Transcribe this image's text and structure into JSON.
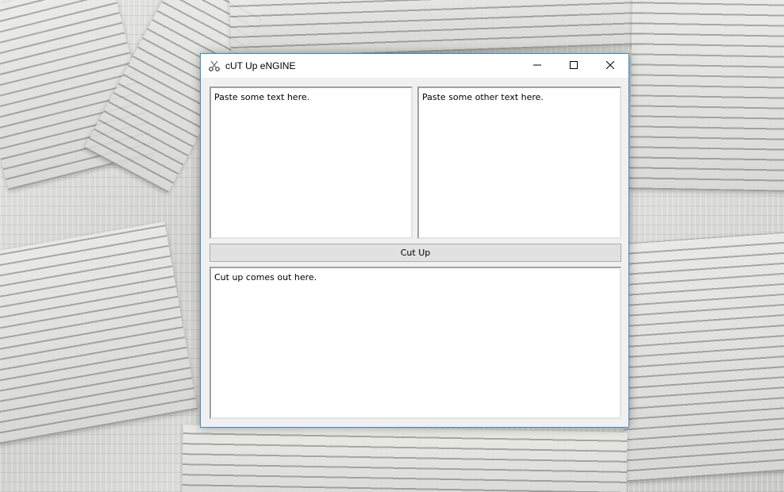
{
  "window": {
    "title": "cUT Up eNGINE",
    "icon": "scissors-icon"
  },
  "controls": {
    "minimize_icon": "minimize-icon",
    "maximize_icon": "maximize-icon",
    "close_icon": "close-icon"
  },
  "inputs": {
    "left_text": "Paste some text here.",
    "right_text": "Paste some other text here."
  },
  "cut_button": {
    "label": "Cut Up"
  },
  "output": {
    "text": "Cut up comes out here."
  },
  "colors": {
    "window_border": "#3b89c9",
    "client_bg": "#f0f0f0",
    "button_bg": "#e1e1e1"
  }
}
